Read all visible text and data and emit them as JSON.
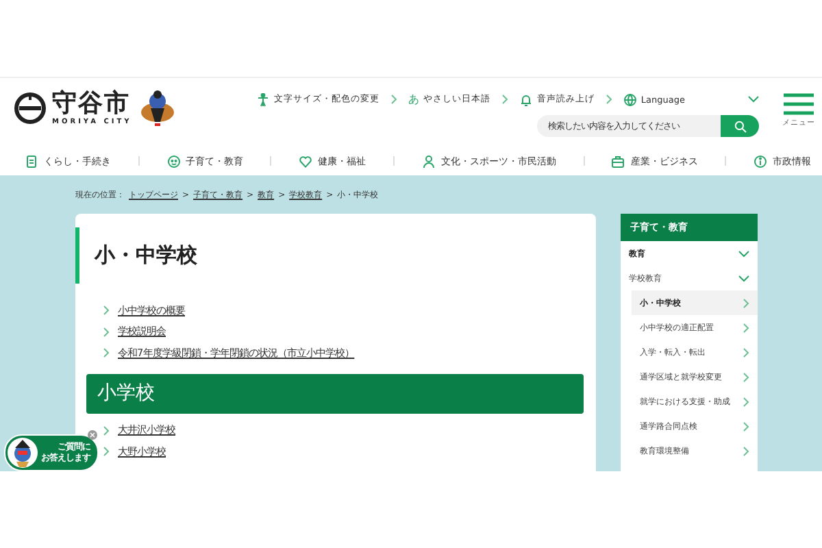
{
  "header": {
    "logo_text": "守谷市",
    "logo_romaji": "MORIYA CITY",
    "utility_links": [
      {
        "label": "文字サイズ・配色の変更"
      },
      {
        "label": "やさしい日本語",
        "glyph": "あ"
      },
      {
        "label": "音声読み上げ"
      },
      {
        "label": "Language"
      }
    ],
    "search": {
      "placeholder": "検索したい内容を入力してください"
    },
    "menu_label": "メニュー"
  },
  "nav": [
    {
      "label": "くらし・手続き"
    },
    {
      "label": "子育て・教育"
    },
    {
      "label": "健康・福祉"
    },
    {
      "label": "文化・スポーツ・市民活動"
    },
    {
      "label": "産業・ビジネス"
    },
    {
      "label": "市政情報"
    }
  ],
  "breadcrumb": {
    "label": "現在の位置：",
    "separator": ">",
    "items": [
      "トップページ",
      "子育て・教育",
      "教育",
      "学校教育"
    ],
    "current": "小・中学校"
  },
  "main": {
    "title": "小・中学校",
    "links": [
      "小中学校の概要",
      "学校説明会",
      "令和7年度学級閉鎖・学年閉鎖の状況（市立小中学校）"
    ],
    "section": {
      "heading": "小学校",
      "links": [
        "大井沢小学校",
        "大野小学校"
      ]
    }
  },
  "sidebar": {
    "title": "子育て・教育",
    "items": [
      {
        "label": "教育",
        "expanded": true,
        "children": [
          {
            "label": "学校教育",
            "expanded": true,
            "children": [
              {
                "label": "小・中学校",
                "selected": true
              },
              {
                "label": "小中学校の適正配置",
                "selected": false
              },
              {
                "label": "入学・転入・転出",
                "selected": false
              },
              {
                "label": "通学区域と就学校変更",
                "selected": false
              },
              {
                "label": "就学における支援・助成",
                "selected": false
              },
              {
                "label": "通学路合同点検",
                "selected": false
              },
              {
                "label": "教育環境整備",
                "selected": false
              }
            ]
          }
        ]
      }
    ]
  },
  "chat_widget": {
    "lines": [
      "ご質問に",
      "お答えします"
    ]
  }
}
